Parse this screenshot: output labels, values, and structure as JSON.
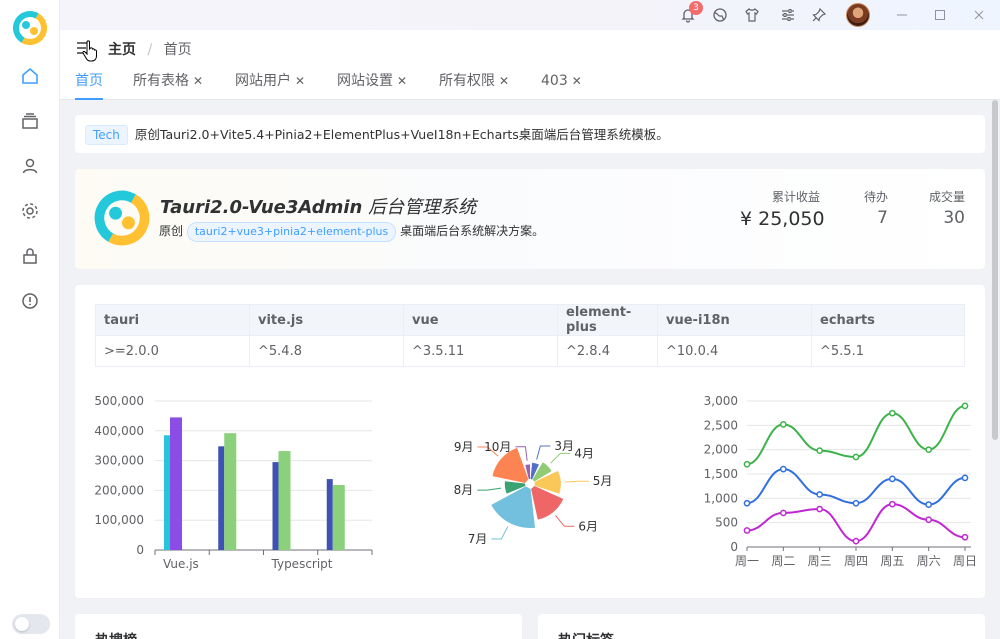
{
  "sidebar": {
    "items": [
      {
        "icon": "home-icon"
      },
      {
        "icon": "layers-icon"
      },
      {
        "icon": "user-icon"
      },
      {
        "icon": "gear-icon"
      },
      {
        "icon": "lock-icon"
      },
      {
        "icon": "alert-circle-icon"
      }
    ],
    "accent": "#409eff"
  },
  "topbar": {
    "notification_count": "3",
    "icons": [
      "bell-icon",
      "globe-icon",
      "shirt-icon",
      "sliders-icon",
      "pin-icon",
      "avatar",
      "minimize-icon",
      "maximize-icon",
      "close-icon"
    ]
  },
  "breadcrumb": {
    "home": "主页",
    "separator": "/",
    "current": "首页"
  },
  "tabs": [
    {
      "label": "首页",
      "closable": false,
      "active": true
    },
    {
      "label": "所有表格",
      "closable": true
    },
    {
      "label": "网站用户",
      "closable": true
    },
    {
      "label": "网站设置",
      "closable": true
    },
    {
      "label": "所有权限",
      "closable": true
    },
    {
      "label": "403",
      "closable": true
    }
  ],
  "notice": {
    "tag": "Tech",
    "text": "原创Tauri2.0+Vite5.4+Pinia2+ElementPlus+VueI18n+Echarts桌面端后台管理系统模板。"
  },
  "hero": {
    "title_bold": "Tauri2.0-Vue3Admin",
    "title_rest": "后台管理系统",
    "subtitle_prefix": "原创",
    "pill": "tauri2+vue3+pinia2+element-plus",
    "subtitle_suffix": "桌面端后台系统解决方案。",
    "stats": [
      {
        "label": "累计收益",
        "value": "¥ 25,050"
      },
      {
        "label": "待办",
        "value": "7"
      },
      {
        "label": "成交量",
        "value": "30"
      }
    ]
  },
  "versions": {
    "headers": [
      "tauri",
      "vite.js",
      "vue",
      "element-plus",
      "vue-i18n",
      "echarts"
    ],
    "values": [
      ">=2.0.0",
      "^5.4.8",
      "^3.5.11",
      "^2.8.4",
      "^10.0.4",
      "^5.5.1"
    ]
  },
  "chart_data": [
    {
      "type": "bar",
      "categories": [
        "Vue.js",
        "",
        "Typescript",
        ""
      ],
      "yticks": [
        "500,000",
        "400,000",
        "300,000",
        "200,000",
        "100,000",
        "0"
      ],
      "ylim": [
        0,
        500000
      ],
      "series": [
        {
          "values": [
            385000,
            348000,
            295000,
            238000
          ]
        },
        {
          "values": [
            445000,
            392000,
            332000,
            218000
          ]
        }
      ],
      "colors": [
        "#26c6da",
        "#8b4de6",
        "#3f51b5",
        "#8bd17c"
      ]
    },
    {
      "type": "pie",
      "labels": [
        "3月",
        "4月",
        "5月",
        "6月",
        "7月",
        "8月",
        "9月",
        "10月"
      ],
      "values": [
        10,
        14,
        20,
        26,
        34,
        14,
        28,
        8
      ],
      "colors": [
        "#5470c6",
        "#91cc75",
        "#fac858",
        "#ee6666",
        "#73c0de",
        "#3ba272",
        "#fc8452",
        "#9a60b4"
      ]
    },
    {
      "type": "line",
      "categories": [
        "周一",
        "周二",
        "周三",
        "周四",
        "周五",
        "周六",
        "周日"
      ],
      "yticks": [
        "3,000",
        "2,500",
        "2,000",
        "1,500",
        "1,000",
        "500",
        "0"
      ],
      "ylim": [
        0,
        3000
      ],
      "series": [
        {
          "color": "#3cb34a",
          "values": [
            1700,
            2520,
            1980,
            1850,
            2750,
            2000,
            2900
          ]
        },
        {
          "color": "#2f6fe0",
          "values": [
            900,
            1600,
            1080,
            900,
            1400,
            870,
            1420
          ]
        },
        {
          "color": "#c026d3",
          "values": [
            340,
            700,
            780,
            120,
            880,
            560,
            200
          ]
        }
      ]
    }
  ],
  "bottom": {
    "left_title": "热搜榜",
    "right_title": "热门标签"
  }
}
